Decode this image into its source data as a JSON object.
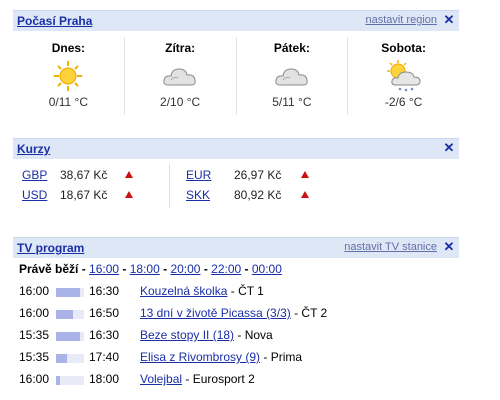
{
  "weather": {
    "title": "Počasí Praha",
    "set_link": "nastavit region",
    "days": [
      {
        "name": "Dnes:",
        "icon": "sun-icon",
        "temp": "0/11 °C"
      },
      {
        "name": "Zítra:",
        "icon": "cloud-icon",
        "temp": "2/10 °C"
      },
      {
        "name": "Pátek:",
        "icon": "cloud-icon",
        "temp": "5/11 °C"
      },
      {
        "name": "Sobota:",
        "icon": "sun-cloud-snow-icon",
        "temp": "-2/6 °C"
      }
    ]
  },
  "rates": {
    "title": "Kurzy",
    "items": [
      {
        "code": "GBP",
        "value": "38,67 Kč",
        "trend": "up"
      },
      {
        "code": "USD",
        "value": "18,67 Kč",
        "trend": "up"
      },
      {
        "code": "EUR",
        "value": "26,97 Kč",
        "trend": "up"
      },
      {
        "code": "SKK",
        "value": "80,92 Kč",
        "trend": "up"
      }
    ]
  },
  "tv": {
    "title": "TV program",
    "set_link": "nastavit TV stanice",
    "now_label": "Právě běží",
    "times": [
      "16:00",
      "18:00",
      "20:00",
      "22:00",
      "00:00"
    ],
    "rows": [
      {
        "start": "16:00",
        "end": "16:30",
        "progress": 0.85,
        "show": "Kouzelná školka",
        "channel": "ČT 1"
      },
      {
        "start": "16:00",
        "end": "16:50",
        "progress": 0.6,
        "show": "13 dní v životě Picassa (3/3)",
        "channel": "ČT 2"
      },
      {
        "start": "15:35",
        "end": "16:30",
        "progress": 0.85,
        "show": "Beze stopy II (18)",
        "channel": "Nova"
      },
      {
        "start": "15:35",
        "end": "17:40",
        "progress": 0.4,
        "show": "Elisa z Rivombrosy (9)",
        "channel": "Prima"
      },
      {
        "start": "16:00",
        "end": "18:00",
        "progress": 0.15,
        "show": "Volejbal",
        "channel": "Eurosport 2"
      }
    ]
  },
  "colors": {
    "header_bg": "#dde7f5",
    "link": "#1a2fa6",
    "trend_up": "#cc1111",
    "progress_fill": "#a9b3e8"
  }
}
